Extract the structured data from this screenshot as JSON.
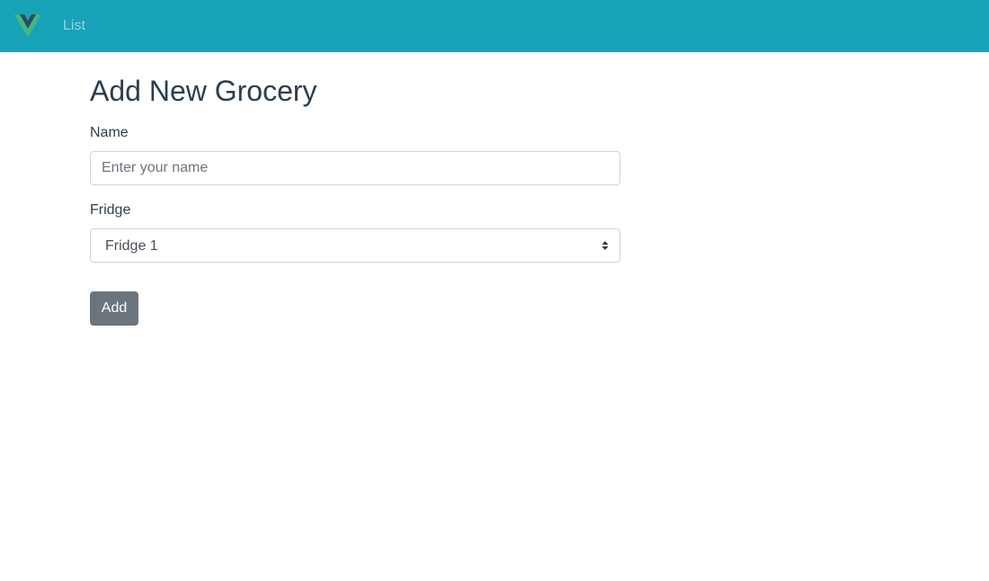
{
  "colors": {
    "navbar_bg": "#17a2b8",
    "button_bg": "#6c757d",
    "logo_outer": "#41b883",
    "logo_inner": "#35495e"
  },
  "navbar": {
    "logo_icon": "vue-logo-icon",
    "link_label": "List"
  },
  "page": {
    "title": "Add New Grocery"
  },
  "form": {
    "name_label": "Name",
    "name_placeholder": "Enter your name",
    "name_value": "",
    "fridge_label": "Fridge",
    "fridge_selected": "Fridge 1",
    "select_icon": "sort-arrows-icon",
    "submit_label": "Add"
  }
}
